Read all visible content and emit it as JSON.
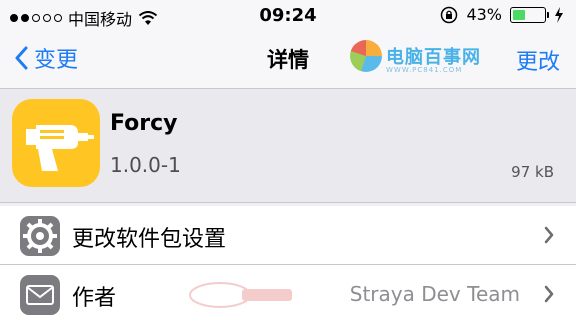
{
  "status_bar": {
    "signal_bars": [
      true,
      true,
      false,
      false,
      false
    ],
    "carrier": "中国移动",
    "time": "09:24",
    "battery_text": "43%",
    "battery_level": 0.43
  },
  "nav": {
    "back_label": "变更",
    "title": "详情",
    "action_label": "更改",
    "watermark_text": "电脑百事网",
    "watermark_sub": "WWW.PC841.COM"
  },
  "package": {
    "name": "Forcy",
    "version": "1.0.0-1",
    "size": "97 kB"
  },
  "rows": [
    {
      "icon": "gear-icon",
      "label": "更改软件包设置",
      "value": ""
    },
    {
      "icon": "mail-icon",
      "label": "作者",
      "value": "Straya Dev Team"
    }
  ],
  "colors": {
    "accent": "#1e7cf5",
    "app_icon": "#fec523",
    "battery_fill": "#4cd964"
  }
}
